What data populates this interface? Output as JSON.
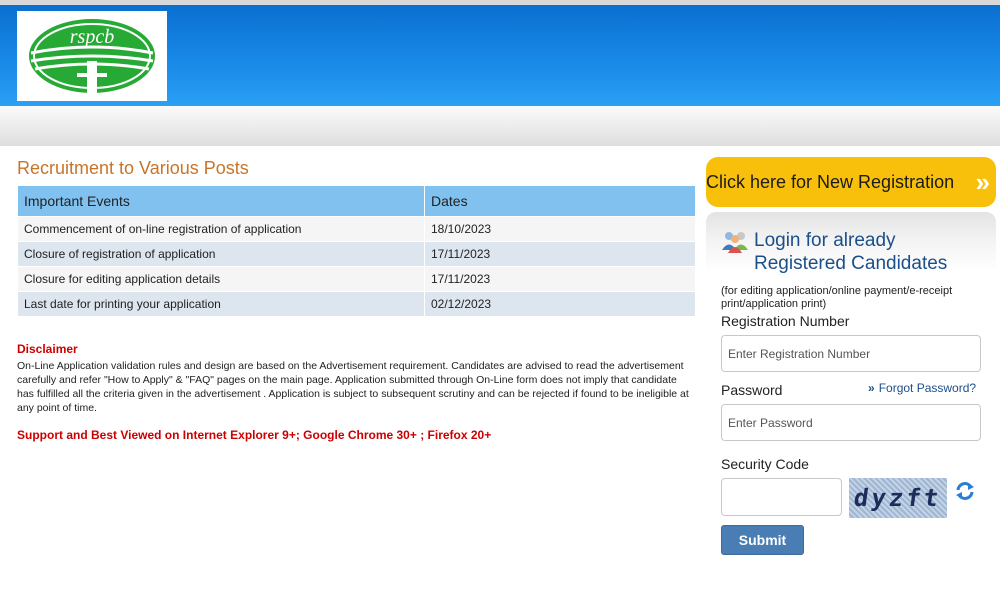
{
  "header": {
    "logo_text": "rspcb"
  },
  "main": {
    "title": "Recruitment to Various Posts",
    "table": {
      "headers": [
        "Important Events",
        "Dates"
      ],
      "rows": [
        {
          "event": "Commencement of on-line registration of application",
          "date": "18/10/2023"
        },
        {
          "event": "Closure of registration of application",
          "date": "17/11/2023"
        },
        {
          "event": "Closure for editing application details",
          "date": "17/11/2023"
        },
        {
          "event": "Last date for printing your application",
          "date": "02/12/2023"
        }
      ]
    },
    "disclaimer": {
      "title": "Disclaimer",
      "text": "On-Line Application validation rules and design are based on the Advertisement requirement. Candidates are advised to read the advertisement carefully and refer \"How to Apply\" & \"FAQ\" pages on the main page. Application submitted through On-Line form does not imply that candidate has fulfilled all the criteria given in the advertisement . Application is subject to subsequent scrutiny and can be rejected if found to be ineligible at any point of time."
    },
    "support_note": "Support and Best Viewed on Internet Explorer 9+; Google Chrome 30+ ; Firefox 20+"
  },
  "sidebar": {
    "new_registration_label": "Click here for New Registration",
    "login": {
      "heading_line1": "Login for already",
      "heading_line2": "Registered Candidates",
      "subtitle": "(for editing application/online payment/e-receipt print/application print)",
      "registration_label": "Registration Number",
      "registration_placeholder": "Enter Registration Number",
      "password_label": "Password",
      "password_placeholder": "Enter Password",
      "forgot_label": "Forgot Password?",
      "security_label": "Security Code",
      "captcha_text": "dyzft",
      "submit_label": "Submit"
    }
  },
  "colors": {
    "header_blue": "#1a8be8",
    "title_orange": "#c8742a",
    "table_header": "#80c1ef",
    "alert_red": "#cc0000",
    "cta_yellow": "#f8c00a",
    "link_blue": "#1b4f8a",
    "button_blue": "#4a7db3"
  },
  "icons": [
    "rspcb-logo",
    "users-icon",
    "chevron-right-icon",
    "refresh-icon"
  ]
}
